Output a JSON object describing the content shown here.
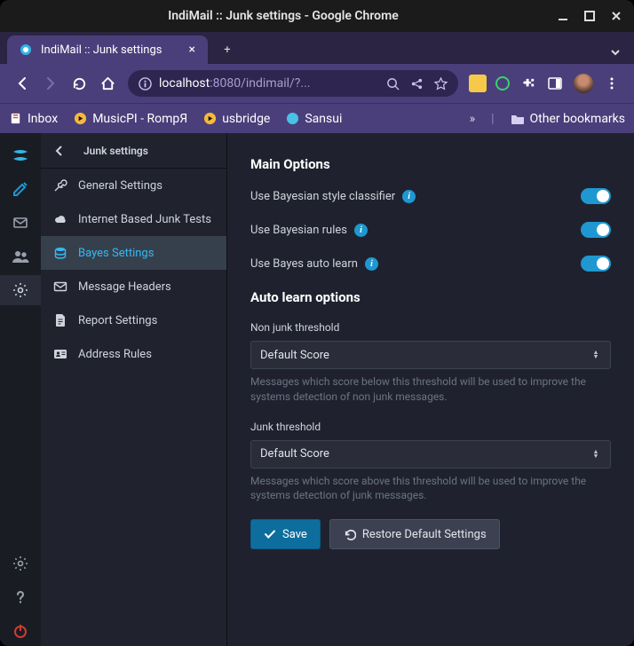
{
  "window": {
    "title": "IndiMail :: Junk settings - Google Chrome"
  },
  "tab": {
    "label": "IndiMail :: Junk settings"
  },
  "url": {
    "host": "localhost",
    "rest": ":8080/indimail/?..."
  },
  "bookmarks": {
    "items": [
      "Inbox",
      "MusicPI - RompЯ",
      "usbridge",
      "Sansui"
    ],
    "other": "Other bookmarks"
  },
  "navhdr": {
    "title": "Junk settings"
  },
  "nav": {
    "items": [
      {
        "id": "general",
        "label": "General Settings"
      },
      {
        "id": "internet-junk",
        "label": "Internet Based Junk Tests"
      },
      {
        "id": "bayes",
        "label": "Bayes Settings"
      },
      {
        "id": "headers",
        "label": "Message Headers"
      },
      {
        "id": "report",
        "label": "Report Settings"
      },
      {
        "id": "address-rules",
        "label": "Address Rules"
      }
    ]
  },
  "main": {
    "section1_title": "Main Options",
    "toggles": [
      {
        "label": "Use Bayesian style classifier"
      },
      {
        "label": "Use Bayesian rules"
      },
      {
        "label": "Use Bayes auto learn"
      }
    ],
    "section2_title": "Auto learn options",
    "nonjunk": {
      "label": "Non junk threshold",
      "value": "Default Score",
      "help": "Messages which score below this threshold will be used to improve the systems detection of non junk messages."
    },
    "junk": {
      "label": "Junk threshold",
      "value": "Default Score",
      "help": "Messages which score above this threshold will be used to improve the systems detection of junk messages."
    },
    "save_label": "Save",
    "restore_label": "Restore Default Settings"
  }
}
